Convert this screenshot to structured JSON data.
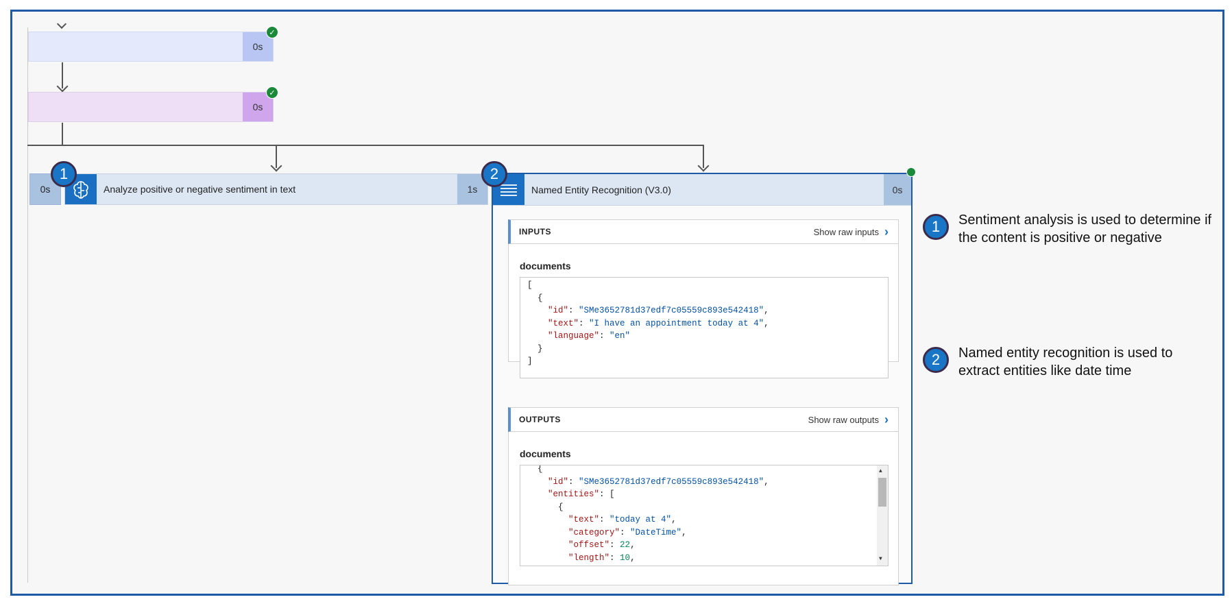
{
  "steps": [
    {
      "duration": "0s"
    },
    {
      "duration": "0s"
    }
  ],
  "branch_left": {
    "badge": "1",
    "left_duration": "0s",
    "icon": "brain-icon",
    "label": "Analyze positive or negative sentiment in text",
    "duration": "1s"
  },
  "branch_right": {
    "badge": "2",
    "icon": "lines-icon",
    "label": "Named Entity Recognition (V3.0)",
    "duration": "0s",
    "inputs": {
      "title": "INPUTS",
      "raw_label": "Show raw inputs",
      "docs_label": "documents",
      "id_key": "\"id\"",
      "id_val": "\"SMe3652781d37edf7c05559c893e542418\"",
      "text_key": "\"text\"",
      "text_val": "\"I have an appointment today at 4\"",
      "lang_key": "\"language\"",
      "lang_val": "\"en\""
    },
    "outputs": {
      "title": "OUTPUTS",
      "raw_label": "Show raw outputs",
      "docs_label": "documents",
      "id_key": "\"id\"",
      "id_val": "\"SMe3652781d37edf7c05559c893e542418\"",
      "entities_key": "\"entities\"",
      "text_key": "\"text\"",
      "text_val": "\"today at 4\"",
      "category_key": "\"category\"",
      "category_val": "\"DateTime\"",
      "offset_key": "\"offset\"",
      "offset_val": "22",
      "length_key": "\"length\"",
      "length_val": "10"
    }
  },
  "notes": [
    {
      "badge": "1",
      "text": "Sentiment analysis is used to determine if the content is positive or negative"
    },
    {
      "badge": "2",
      "text": "Named entity recognition is used to extract entities like date time"
    }
  ],
  "colors": {
    "frame": "#1f5aa6",
    "step1_bg": "#e4e9fb",
    "step1_dur": "#b9c5f3",
    "step2_bg": "#eedff7",
    "step2_dur": "#cfa6ec",
    "action_icon": "#1a6fc2",
    "badge": "#1976c7",
    "success": "#1a8a3a"
  }
}
